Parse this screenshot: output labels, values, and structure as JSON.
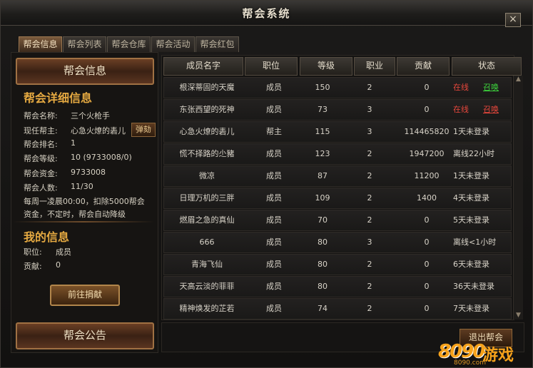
{
  "window": {
    "title": "帮会系统",
    "close_label": "×"
  },
  "tabs": [
    {
      "label": "帮会信息",
      "active": true
    },
    {
      "label": "帮会列表",
      "active": false
    },
    {
      "label": "帮会仓库",
      "active": false
    },
    {
      "label": "帮会活动",
      "active": false
    },
    {
      "label": "帮会红包",
      "active": false
    }
  ],
  "left": {
    "header": "帮会信息",
    "detail_title": "帮会详细信息",
    "guild_name_label": "帮会名称:",
    "guild_name": "三个火枪手",
    "leader_label": "现任帮主:",
    "leader": "心急火燎的砉儿",
    "kick_label": "弹劾",
    "rank_label": "帮会排名:",
    "rank": "1",
    "level_label": "帮会等级:",
    "level": "10 (9733008/0)",
    "funds_label": "帮会资金:",
    "funds": "9733008",
    "members_label": "帮会人数:",
    "members": "11/30",
    "note_line1": "每周一凌晨00:00，扣除5000帮会",
    "note_line2": "资金，不定时，帮会自动降级",
    "my_info_title": "我的信息",
    "position_label": "职位:",
    "position": "成员",
    "contrib_label": "贡献:",
    "contrib": "0",
    "donate_button": "前往捐献",
    "notice_header": "帮会公告"
  },
  "table": {
    "headers": [
      "成员名字",
      "职位",
      "等级",
      "职业",
      "贡献",
      "状态"
    ],
    "rows": [
      {
        "name": "根深蒂固的天魔",
        "position": "成员",
        "level": "150",
        "job": "2",
        "contrib": "0",
        "status": "在线",
        "online": true,
        "summon": "召唤",
        "summon_color": "#3dd63d"
      },
      {
        "name": "东张西望的死神",
        "position": "成员",
        "level": "73",
        "job": "3",
        "contrib": "0",
        "status": "在线",
        "online": true,
        "summon": "召唤",
        "summon_color": "#e8473c"
      },
      {
        "name": "心急火燎的砉儿",
        "position": "帮主",
        "level": "115",
        "job": "3",
        "contrib": "114465820",
        "status": "1天未登录",
        "online": false
      },
      {
        "name": "慌不择路的尐豬",
        "position": "成员",
        "level": "123",
        "job": "2",
        "contrib": "1947200",
        "status": "离线22小时",
        "online": false
      },
      {
        "name": "微凉",
        "position": "成员",
        "level": "87",
        "job": "2",
        "contrib": "11200",
        "status": "1天未登录",
        "online": false
      },
      {
        "name": "日理万机的三胖",
        "position": "成员",
        "level": "109",
        "job": "2",
        "contrib": "1400",
        "status": "4天未登录",
        "online": false
      },
      {
        "name": "燃眉之急的真仙",
        "position": "成员",
        "level": "70",
        "job": "2",
        "contrib": "0",
        "status": "5天未登录",
        "online": false
      },
      {
        "name": "666",
        "position": "成员",
        "level": "80",
        "job": "3",
        "contrib": "0",
        "status": "离线<1小时",
        "online": false
      },
      {
        "name": "青海飞仙",
        "position": "成员",
        "level": "80",
        "job": "2",
        "contrib": "0",
        "status": "6天未登录",
        "online": false
      },
      {
        "name": "天高云淡的菲菲",
        "position": "成员",
        "level": "80",
        "job": "2",
        "contrib": "0",
        "status": "36天未登录",
        "online": false
      },
      {
        "name": "精神焕发的芷若",
        "position": "成员",
        "level": "74",
        "job": "2",
        "contrib": "0",
        "status": "7天未登录",
        "online": false
      }
    ]
  },
  "quit_button": "退出帮会",
  "watermark": {
    "number": "8090",
    "text": "游戏",
    "url": "8090.com"
  }
}
